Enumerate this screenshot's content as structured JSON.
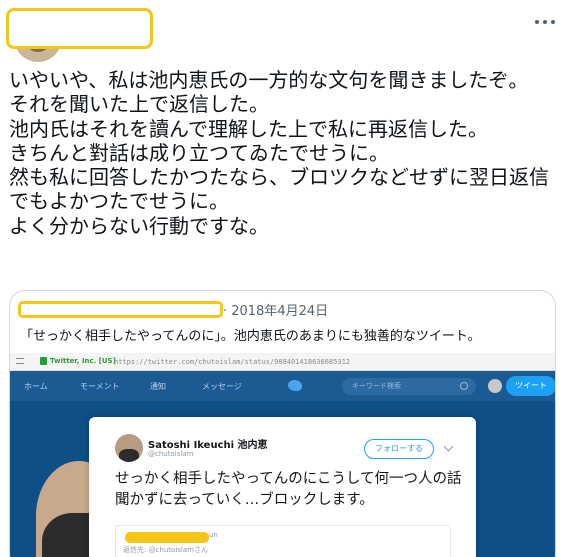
{
  "tweet": {
    "text": "いやいや、私は池内恵氏の一方的な文句を聞きましたぞ。\nそれを聞いた上で返信した。\n池内氏はそれを讀んで理解した上で私に再返信した。\nきちんと對話は成り立つてゐたでせうに。\n然も私に回答したかつたなら、ブロツクなどせずに翌日返信でもよかつたでせうに。\nよく分からない行動ですな。"
  },
  "quote": {
    "date": "· 2018年4月24日",
    "text": "「せっかく相手したやってんのに」。池内恵氏のあまりにも独善的なツイート。",
    "screenshot": {
      "url_site": "Twitter, Inc. [US]",
      "url_path": "https://twitter.com/chutoislam/status/988401418636685312",
      "nav": {
        "home": "ホーム",
        "moments": "モーメント",
        "notifications": "通知",
        "messages": "メッセージ",
        "search_placeholder": "キーワード検索",
        "tweet_button": "ツイート"
      },
      "card": {
        "name": "Satoshi Ikeuchi 池内恵",
        "handle": "@chutoislam",
        "follow": "フォローする",
        "text": "せっかく相手したやってんのにこうして何一つ人の話聞かずに去っていく…ブロックします。",
        "reply_suffix": "un",
        "reply_to": "返信先: @chutoislamさん"
      }
    }
  },
  "colors": {
    "redaction": "#f5c518",
    "twitter_blue": "#1da1f2",
    "nav_bg": "#1b5a92"
  }
}
